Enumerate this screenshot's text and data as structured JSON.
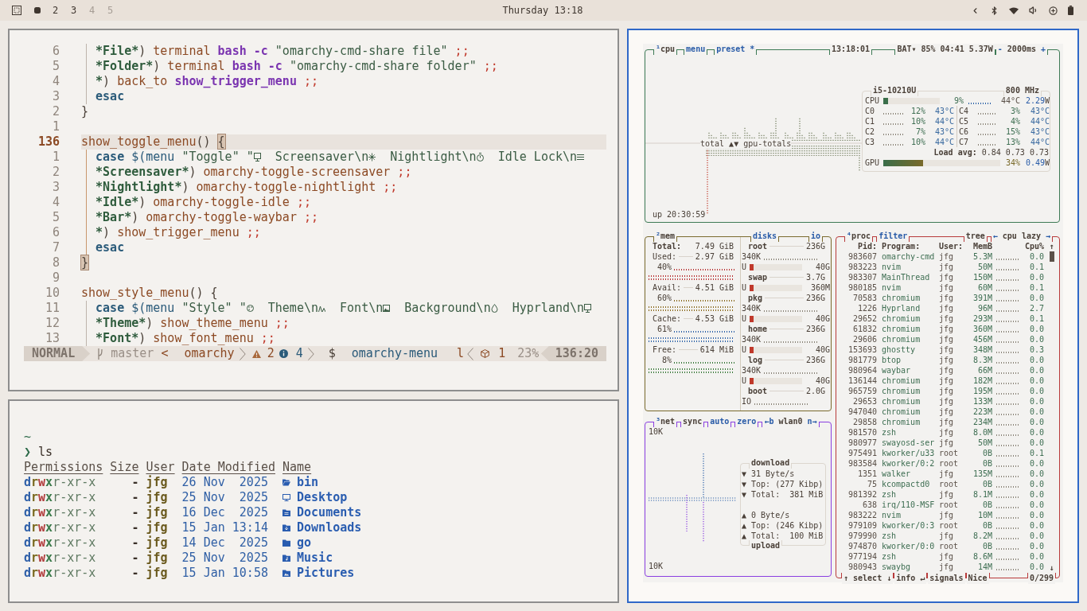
{
  "top_bar": {
    "workspaces": [
      {
        "selected": true,
        "occupied": true
      },
      {
        "label": "2",
        "selected": false,
        "occupied": true
      },
      {
        "label": "3",
        "selected": false,
        "occupied": true
      },
      {
        "label": "4",
        "selected": false,
        "occupied": false
      },
      {
        "label": "5",
        "selected": false,
        "occupied": false
      }
    ],
    "clock": "Thursday 13:18"
  },
  "editor": {
    "focused": false,
    "lines": [
      {
        "children": [
          {
            "number": "6",
            "current": false,
            "tokens": [
              {
                "text": "*File*",
                "kind": "pattern"
              },
              {
                "text": ") ",
                "kind": "plain"
              },
              {
                "text": "terminal ",
                "kind": "command"
              },
              {
                "text": "bash -c ",
                "kind": "builtin"
              },
              {
                "text": "\"omarchy-cmd-share file\" ",
                "kind": "string"
              },
              {
                "text": ";;",
                "kind": "separator"
              }
            ]
          },
          {
            "number": "5",
            "current": false,
            "tokens": [
              {
                "text": "*Folder*",
                "kind": "pattern"
              },
              {
                "text": ") ",
                "kind": "plain"
              },
              {
                "text": "terminal ",
                "kind": "command"
              },
              {
                "text": "bash -c ",
                "kind": "builtin"
              },
              {
                "text": "\"omarchy-cmd-share folder\" ",
                "kind": "string"
              },
              {
                "text": ";;",
                "kind": "separator"
              }
            ]
          },
          {
            "number": "4",
            "current": false,
            "tokens": [
              {
                "text": "*",
                "kind": "pattern"
              },
              {
                "text": ") ",
                "kind": "plain"
              },
              {
                "text": "back_to ",
                "kind": "command"
              },
              {
                "text": "show_trigger_menu ",
                "kind": "builtin"
              },
              {
                "text": ";;",
                "kind": "separator"
              }
            ]
          },
          {
            "number": "3",
            "current": false,
            "tokens": [
              {
                "text": "esac",
                "kind": "keyword"
              }
            ]
          }
        ]
      },
      {
        "number": "2",
        "current": false,
        "tokens": [
          {
            "text": "}",
            "kind": "plain"
          }
        ]
      },
      {
        "number": "1",
        "current": false
      },
      {
        "number": "136",
        "current": true,
        "tokens": [
          {
            "text": "show_toggle_menu",
            "kind": "function"
          },
          {
            "text": "() ",
            "kind": "plain"
          },
          {
            "text": "{",
            "kind": "match"
          }
        ],
        "children": [
          {
            "number": "1",
            "current": false,
            "tokens": [
              {
                "text": "case ",
                "kind": "keyword"
              },
              {
                "text": "$(menu ",
                "kind": "subst"
              },
              {
                "text": "\"Toggle\" \"",
                "kind": "string"
              },
              {
                "kind": "icon_monitor"
              },
              {
                "text": "  Screensaver\\n",
                "kind": "string"
              },
              {
                "kind": "icon_sparkle"
              },
              {
                "text": "  Nightlight\\n",
                "kind": "string"
              },
              {
                "kind": "icon_timer"
              },
              {
                "text": "  Idle Lock\\n",
                "kind": "string"
              },
              {
                "kind": "icon_lines"
              }
            ]
          },
          {
            "number": "2",
            "current": false,
            "tokens": [
              {
                "text": "*Screensaver*",
                "kind": "pattern"
              },
              {
                "text": ") ",
                "kind": "plain"
              },
              {
                "text": "omarchy-toggle-screensaver ",
                "kind": "command"
              },
              {
                "text": ";;",
                "kind": "separator"
              }
            ]
          },
          {
            "number": "3",
            "current": false,
            "tokens": [
              {
                "text": "*Nightlight*",
                "kind": "pattern"
              },
              {
                "text": ") ",
                "kind": "plain"
              },
              {
                "text": "omarchy-toggle-nightlight ",
                "kind": "command"
              },
              {
                "text": ";;",
                "kind": "separator"
              }
            ]
          },
          {
            "number": "4",
            "current": false,
            "tokens": [
              {
                "text": "*Idle*",
                "kind": "pattern"
              },
              {
                "text": ") ",
                "kind": "plain"
              },
              {
                "text": "omarchy-toggle-idle ",
                "kind": "command"
              },
              {
                "text": ";;",
                "kind": "separator"
              }
            ]
          },
          {
            "number": "5",
            "current": false,
            "tokens": [
              {
                "text": "*Bar*",
                "kind": "pattern"
              },
              {
                "text": ") ",
                "kind": "plain"
              },
              {
                "text": "omarchy-toggle-waybar ",
                "kind": "command"
              },
              {
                "text": ";;",
                "kind": "separator"
              }
            ]
          },
          {
            "number": "6",
            "current": false,
            "tokens": [
              {
                "text": "*",
                "kind": "pattern"
              },
              {
                "text": ") ",
                "kind": "plain"
              },
              {
                "text": "show_trigger_menu ",
                "kind": "command"
              },
              {
                "text": ";;",
                "kind": "separator"
              }
            ]
          },
          {
            "number": "7",
            "current": false,
            "tokens": [
              {
                "text": "esac",
                "kind": "keyword"
              }
            ]
          }
        ]
      },
      {
        "number": "8",
        "current": false,
        "tokens": [
          {
            "text": "}",
            "kind": "match"
          }
        ]
      },
      {
        "number": "9",
        "current": false
      },
      {
        "number": "10",
        "current": false,
        "tokens": [
          {
            "text": "show_style_menu",
            "kind": "function"
          },
          {
            "text": "() {",
            "kind": "plain"
          }
        ],
        "children": [
          {
            "number": "11",
            "current": false,
            "tokens": [
              {
                "text": "case ",
                "kind": "keyword"
              },
              {
                "text": "$(menu ",
                "kind": "subst"
              },
              {
                "text": "\"Style\" \"",
                "kind": "string"
              },
              {
                "kind": "icon_palette"
              },
              {
                "text": "  Theme\\n",
                "kind": "string"
              },
              {
                "kind": "icon_font"
              },
              {
                "text": "  Font\\n",
                "kind": "string"
              },
              {
                "kind": "icon_image"
              },
              {
                "text": "  Background\\n",
                "kind": "string"
              },
              {
                "kind": "icon_drop"
              },
              {
                "text": "  Hyprland\\n",
                "kind": "string"
              },
              {
                "kind": "icon_monitor"
              }
            ]
          },
          {
            "number": "12",
            "current": false,
            "tokens": [
              {
                "text": "*Theme*",
                "kind": "pattern"
              },
              {
                "text": ") ",
                "kind": "plain"
              },
              {
                "text": "show_theme_menu ",
                "kind": "command"
              },
              {
                "text": ";;",
                "kind": "separator"
              }
            ]
          },
          {
            "number": "13",
            "current": false,
            "tokens": [
              {
                "text": "*Font*",
                "kind": "pattern"
              },
              {
                "text": ") ",
                "kind": "plain"
              },
              {
                "text": "show_font_menu ",
                "kind": "command"
              },
              {
                "text": ";;",
                "kind": "separator"
              }
            ]
          }
        ]
      }
    ],
    "statusline": {
      "mode": "NORMAL",
      "branch": "master",
      "cwd_prefix": "<",
      "cwd": "omarchy",
      "warnings": "2",
      "infos": "4",
      "filetype": "$",
      "file": "omarchy-menu",
      "indicator": "l",
      "count": "1",
      "progress": "23%",
      "position": "136:20"
    }
  },
  "terminal": {
    "focused": false,
    "cwd": "~",
    "prompt": "❯",
    "command": "ls",
    "columns": [
      "Permissions",
      "Size",
      "User",
      "Date Modified",
      "Name"
    ],
    "rows": [
      {
        "permissions": [
          "d",
          "r",
          "w",
          "x",
          "r-xr-x"
        ],
        "size": "-",
        "user": "jfg",
        "date": "26 Nov  2025",
        "kind": "open_folder",
        "name": "bin"
      },
      {
        "permissions": [
          "d",
          "r",
          "w",
          "x",
          "r-xr-x"
        ],
        "size": "-",
        "user": "jfg",
        "date": "25 Nov  2025",
        "kind": "desktop",
        "name": "Desktop"
      },
      {
        "permissions": [
          "d",
          "r",
          "w",
          "x",
          "r-xr-x"
        ],
        "size": "-",
        "user": "jfg",
        "date": "16 Dec  2025",
        "kind": "documents",
        "name": "Documents"
      },
      {
        "permissions": [
          "d",
          "r",
          "w",
          "x",
          "r-xr-x"
        ],
        "size": "-",
        "user": "jfg",
        "date": "15 Jan 13:14",
        "kind": "downloads",
        "name": "Downloads"
      },
      {
        "permissions": [
          "d",
          "r",
          "w",
          "x",
          "r-xr-x"
        ],
        "size": "-",
        "user": "jfg",
        "date": "14 Dec  2025",
        "kind": "folder",
        "name": "go"
      },
      {
        "permissions": [
          "d",
          "r",
          "w",
          "x",
          "r-xr-x"
        ],
        "size": "-",
        "user": "jfg",
        "date": "25 Nov  2025",
        "kind": "music",
        "name": "Music"
      },
      {
        "permissions": [
          "d",
          "r",
          "w",
          "x",
          "r-xr-x"
        ],
        "size": "-",
        "user": "jfg",
        "date": "15 Jan 10:58",
        "kind": "pictures",
        "name": "Pictures"
      }
    ]
  },
  "btop": {
    "focused": true,
    "cpu": {
      "titles_left": [
        {
          "hotkey": "¹",
          "label": "cpu",
          "highlighted": false
        },
        {
          "label": "menu",
          "highlighted": true
        },
        {
          "label": "preset *",
          "highlighted": true
        }
      ],
      "clock": "13:18:01",
      "titles_right": [
        {
          "label": "BAT▾ 85% 04:41 5.37W",
          "highlighted": false
        },
        {
          "prefix": "-",
          "label": "2000ms",
          "suffix": "+",
          "highlighted": false
        }
      ],
      "graph_label": "total ▲▼ gpu-totals",
      "uptime": "up 20:30:59",
      "model": "i5-10210U",
      "frequency": "800 MHz",
      "total": {
        "label": "CPU",
        "level": 0.09,
        "percent": "9%",
        "temp": "44°C",
        "power": "2.29",
        "power_unit": "W"
      },
      "cores": [
        {
          "label": "C0",
          "percent": "12%",
          "temp": "43°C"
        },
        {
          "label": "C1",
          "percent": "10%",
          "temp": "44°C"
        },
        {
          "label": "C2",
          "percent": "7%",
          "temp": "43°C"
        },
        {
          "label": "C3",
          "percent": "10%",
          "temp": "44°C"
        },
        {
          "label": "C4",
          "percent": "3%",
          "temp": "43°C"
        },
        {
          "label": "C5",
          "percent": "4%",
          "temp": "44°C"
        },
        {
          "label": "C6",
          "percent": "15%",
          "temp": "43°C"
        },
        {
          "label": "C7",
          "percent": "13%",
          "temp": "44°C"
        }
      ],
      "load_label": "Load avg:",
      "load": [
        "0.84",
        "0.73",
        "0.73"
      ],
      "gpu": {
        "label": "GPU",
        "level": 0.34,
        "percent": "34%",
        "power": "0.49",
        "power_unit": "W"
      }
    },
    "mem": {
      "titles": [
        {
          "hotkey": "²",
          "label": "mem",
          "highlighted": false
        }
      ],
      "disk_titles": [
        {
          "label": "disks",
          "highlighted": true
        },
        {
          "label": "io",
          "highlighted": true
        }
      ],
      "total": {
        "label": "Total:",
        "value": "7.49 GiB"
      },
      "meters": [
        {
          "label": "Used:",
          "value": "2.97 GiB",
          "percent": "40%",
          "color": "#b83232"
        },
        {
          "label": "Avail:",
          "value": "4.51 GiB",
          "percent": "60%",
          "color": "#8a6a1e"
        },
        {
          "label": "Cache:",
          "value": "4.53 GiB",
          "percent": "61%",
          "color": "#2e62a8"
        },
        {
          "label": "Free:",
          "value": "614 MiB",
          "percent": "8%",
          "color": "#3a7a3a"
        }
      ],
      "disks": [
        {
          "name": "root",
          "size": "236G",
          "io": "340K",
          "used_label": "U",
          "level": 0.08,
          "used": "40G"
        },
        {
          "name": "swap",
          "size": "3.7G",
          "used_label": "U",
          "level": 0.08,
          "used": "360M"
        },
        {
          "name": "pkg",
          "size": "236G",
          "io": "340K",
          "used_label": "U",
          "level": 0.08,
          "used": "40G"
        },
        {
          "name": "home",
          "size": "236G",
          "io": "340K",
          "used_label": "U",
          "level": 0.08,
          "used": "40G"
        },
        {
          "name": "log",
          "size": "236G",
          "io": "340K",
          "used_label": "U",
          "level": 0.08,
          "used": "40G"
        },
        {
          "name": "boot",
          "size": "2.0G",
          "io": "IO"
        }
      ]
    },
    "net": {
      "titles": [
        {
          "hotkey": "³",
          "label": "net",
          "highlighted": false
        },
        {
          "label": "sync",
          "highlighted": false
        },
        {
          "label": "auto",
          "highlighted": true
        },
        {
          "label": "zero",
          "highlighted": true
        },
        {
          "prefix": "←b",
          "label": "wlan0",
          "suffix": "n→",
          "highlighted": false
        }
      ],
      "scale_top": "10K",
      "scale_bottom": "10K",
      "download_title": "download",
      "download": [
        "▼ 31 Byte/s",
        "▼ Top: (277 Kibp)",
        "▼ Total:  381 MiB"
      ],
      "upload": [
        "▲ 0 Byte/s",
        "▲ Top: (246 Kibp)",
        "▲ Total:  100 MiB"
      ],
      "upload_title": "upload"
    },
    "proc": {
      "titles_left": [
        {
          "hotkey": "⁴",
          "label": "proc",
          "highlighted": false
        },
        {
          "label": "filter",
          "highlighted": true
        }
      ],
      "titles_right": [
        {
          "label": "tree",
          "highlighted": false
        },
        {
          "prefix": "←",
          "label": "cpu lazy",
          "suffix": "→",
          "highlighted": false
        }
      ],
      "columns": [
        "Pid:",
        "Program:",
        "User:",
        "MemB",
        "Cpu%"
      ],
      "scroll_up": "↑",
      "scroll_down": "↓",
      "rows": [
        {
          "pid": "983607",
          "program": "omarchy-cmd",
          "user": "jfg",
          "mem": "5.3M",
          "cpu": "0.0"
        },
        {
          "pid": "983223",
          "program": "nvim",
          "user": "jfg",
          "mem": "50M",
          "cpu": "0.1"
        },
        {
          "pid": "983307",
          "program": "MainThread",
          "user": "jfg",
          "mem": "150M",
          "cpu": "0.0"
        },
        {
          "pid": "980185",
          "program": "nvim",
          "user": "jfg",
          "mem": "60M",
          "cpu": "0.1"
        },
        {
          "pid": "70583",
          "program": "chromium",
          "user": "jfg",
          "mem": "391M",
          "cpu": "0.0"
        },
        {
          "pid": "1226",
          "program": "Hyprland",
          "user": "jfg",
          "mem": "96M",
          "cpu": "2.7"
        },
        {
          "pid": "29652",
          "program": "chromium",
          "user": "jfg",
          "mem": "293M",
          "cpu": "0.1"
        },
        {
          "pid": "61832",
          "program": "chromium",
          "user": "jfg",
          "mem": "360M",
          "cpu": "0.0"
        },
        {
          "pid": "29606",
          "program": "chromium",
          "user": "jfg",
          "mem": "456M",
          "cpu": "0.0"
        },
        {
          "pid": "153693",
          "program": "ghostty",
          "user": "jfg",
          "mem": "348M",
          "cpu": "0.3"
        },
        {
          "pid": "981779",
          "program": "btop",
          "user": "jfg",
          "mem": "8.3M",
          "cpu": "0.0"
        },
        {
          "pid": "980964",
          "program": "waybar",
          "user": "jfg",
          "mem": "66M",
          "cpu": "0.0"
        },
        {
          "pid": "136144",
          "program": "chromium",
          "user": "jfg",
          "mem": "182M",
          "cpu": "0.0"
        },
        {
          "pid": "965759",
          "program": "chromium",
          "user": "jfg",
          "mem": "195M",
          "cpu": "0.0"
        },
        {
          "pid": "29653",
          "program": "chromium",
          "user": "jfg",
          "mem": "133M",
          "cpu": "0.0"
        },
        {
          "pid": "947040",
          "program": "chromium",
          "user": "jfg",
          "mem": "223M",
          "cpu": "0.0"
        },
        {
          "pid": "29858",
          "program": "chromium",
          "user": "jfg",
          "mem": "234M",
          "cpu": "0.0"
        },
        {
          "pid": "981570",
          "program": "zsh",
          "user": "jfg",
          "mem": "8.0M",
          "cpu": "0.0"
        },
        {
          "pid": "980977",
          "program": "swayosd-ser",
          "user": "jfg",
          "mem": "50M",
          "cpu": "0.0"
        },
        {
          "pid": "975491",
          "program": "kworker/u33",
          "user": "root",
          "mem": "0B",
          "cpu": "0.1"
        },
        {
          "pid": "983584",
          "program": "kworker/0:2",
          "user": "root",
          "mem": "0B",
          "cpu": "0.0"
        },
        {
          "pid": "1351",
          "program": "walker",
          "user": "jfg",
          "mem": "135M",
          "cpu": "0.0"
        },
        {
          "pid": "75",
          "program": "kcompactd0",
          "user": "root",
          "mem": "0B",
          "cpu": "0.0"
        },
        {
          "pid": "981392",
          "program": "zsh",
          "user": "jfg",
          "mem": "8.1M",
          "cpu": "0.0"
        },
        {
          "pid": "638",
          "program": "irq/110-MSF",
          "user": "root",
          "mem": "0B",
          "cpu": "0.0"
        },
        {
          "pid": "983222",
          "program": "nvim",
          "user": "jfg",
          "mem": "10M",
          "cpu": "0.0"
        },
        {
          "pid": "979109",
          "program": "kworker/0:3",
          "user": "root",
          "mem": "0B",
          "cpu": "0.0"
        },
        {
          "pid": "979990",
          "program": "zsh",
          "user": "jfg",
          "mem": "8.2M",
          "cpu": "0.0"
        },
        {
          "pid": "974870",
          "program": "kworker/0:0",
          "user": "root",
          "mem": "0B",
          "cpu": "0.0"
        },
        {
          "pid": "977194",
          "program": "zsh",
          "user": "jfg",
          "mem": "8.6M",
          "cpu": "0.0"
        },
        {
          "pid": "980943",
          "program": "swaybg",
          "user": "jfg",
          "mem": "14M",
          "cpu": "0.0"
        }
      ],
      "footer_left": [
        "↑ select ↓",
        "info ↵",
        "signals",
        "Nice"
      ],
      "footer_right": "0/299"
    }
  }
}
